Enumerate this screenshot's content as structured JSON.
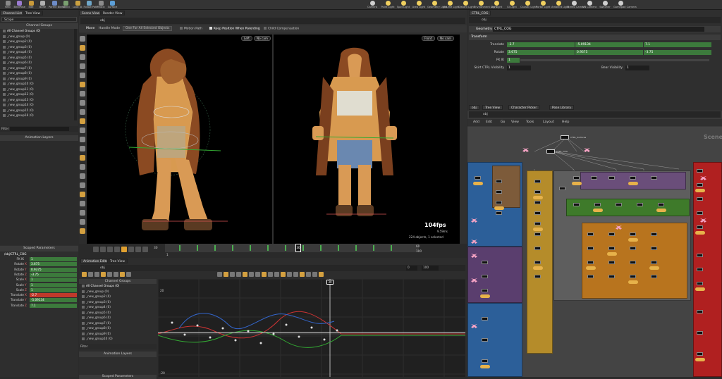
{
  "shelf_tools": [
    {
      "label": "Rest",
      "color": "#8a8a8a"
    },
    {
      "label": "BindPose",
      "color": "#9b7bd1"
    },
    {
      "label": "Edit",
      "color": "#c99a3a"
    },
    {
      "label": "Bone",
      "color": "#b0b0b0"
    },
    {
      "label": "Parent Blend",
      "color": "#6d8cc7"
    },
    {
      "label": "Blend",
      "color": "#7aa070"
    },
    {
      "label": "Look At",
      "color": "#caa040"
    },
    {
      "label": "Follow Path",
      "color": "#6fa7c9"
    },
    {
      "label": "Plastic",
      "color": "#8c8c8c"
    },
    {
      "label": "Surface",
      "color": "#5c9fd8"
    }
  ],
  "light_tools": [
    {
      "label": "Camera",
      "color": "#cfcfcf"
    },
    {
      "label": "Point Light",
      "color": "#f0d060"
    },
    {
      "label": "Spot Light",
      "color": "#f0d060"
    },
    {
      "label": "Area Light",
      "color": "#f0d060"
    },
    {
      "label": "Geometry Light",
      "color": "#f0d060"
    },
    {
      "label": "Volume Light",
      "color": "#f0d060"
    },
    {
      "label": "Distant Light",
      "color": "#f0d060"
    },
    {
      "label": "Environment Light",
      "color": "#f0d060"
    },
    {
      "label": "Sky Light",
      "color": "#f0d060"
    },
    {
      "label": "GI Light",
      "color": "#f0d060"
    },
    {
      "label": "Caustic Light",
      "color": "#f0d060"
    },
    {
      "label": "Portal Light",
      "color": "#f0d060"
    },
    {
      "label": "Ambient Light",
      "color": "#f0d060"
    },
    {
      "label": "Stereo Camera",
      "color": "#cfcfcf"
    },
    {
      "label": "VR Camera",
      "color": "#cfcfcf"
    },
    {
      "label": "Switcher",
      "color": "#cfcfcf"
    },
    {
      "label": "Gamepad Camera",
      "color": "#cfcfcf"
    }
  ],
  "left_tabs": [
    "Channel List",
    "Tree View"
  ],
  "scope_label": "Scope",
  "channel_groups": {
    "title": "Channel Groups",
    "items": [
      "All Channel Groups (0)",
      "_new_group (0)",
      "_new_group2 (0)",
      "_new_group3 (0)",
      "_new_group4 (0)",
      "_new_group5 (0)",
      "_new_group6 (0)",
      "_new_group7 (0)",
      "_new_group8 (0)",
      "_new_group9 (0)",
      "_new_group10 (0)",
      "_new_group11 (0)",
      "_new_group12 (0)",
      "_new_group13 (0)",
      "_new_group14 (0)",
      "_new_group15 (0)",
      "_new_group16 (0)"
    ]
  },
  "filter_label": "Filter",
  "anim_layers_title": "Animation Layers",
  "scoped_params": {
    "title": "Scoped Parameters",
    "node": "/obj/CTRL_COG",
    "rows": [
      {
        "name": "FK IK",
        "axis": "",
        "value": "1",
        "color": "#3c7a3c"
      },
      {
        "name": "Rotate",
        "axis": "X",
        "value": "3.675",
        "color": "#3c7a3c"
      },
      {
        "name": "Rotate",
        "axis": "Y",
        "value": "0.9375",
        "color": "#3c7a3c"
      },
      {
        "name": "Rotate",
        "axis": "Z",
        "value": "-3.75",
        "color": "#3c7a3c"
      },
      {
        "name": "Scale",
        "axis": "X",
        "value": "1",
        "color": "#3c7a3c"
      },
      {
        "name": "Scale",
        "axis": "Y",
        "value": "1",
        "color": "#3c7a3c"
      },
      {
        "name": "Scale",
        "axis": "Z",
        "value": "1",
        "color": "#3c7a3c"
      },
      {
        "name": "Translate",
        "axis": "X",
        "value": "-2.7",
        "color": "#c0392b"
      },
      {
        "name": "Translate",
        "axis": "Y",
        "value": "-5.09134",
        "color": "#3c7a3c"
      },
      {
        "name": "Translate",
        "axis": "Z",
        "value": "7.1",
        "color": "#3c7a3c"
      }
    ]
  },
  "center_tabs": [
    "Scene View",
    "Render View"
  ],
  "path_obj": "obj",
  "viewport_toolbar": {
    "mode": "Move",
    "handle": "Handle Mode",
    "objects": "One For All Selected Objects",
    "motion_path": "Motion Path",
    "keep_pos": "Keep Position When Parenting",
    "child_comp": "Child Compensation"
  },
  "viewport_left": {
    "view": "Left",
    "cam": "No cam"
  },
  "viewport_right": {
    "view": "Front",
    "cam": "No cam"
  },
  "fps": "104fps",
  "fps_sub": "9.59ms",
  "objects_status": "224 objects, 1 selected",
  "timeline": {
    "start": "1",
    "current": "30",
    "end": "60",
    "end2": "100",
    "frame_marker": "30"
  },
  "anim_editor": {
    "tabs": [
      "Animation Editor",
      "Tree View"
    ],
    "path": "obj",
    "frame_start": "0",
    "frame_end": "100",
    "graph_frame": "30",
    "y_top": "20",
    "y_bottom": "-20"
  },
  "anim_channel_groups": {
    "title": "Channel Groups",
    "items": [
      "All Channel Groups (0)",
      "_new_group (0)",
      "_new_group2 (0)",
      "_new_group3 (0)",
      "_new_group4 (0)",
      "_new_group5 (0)",
      "_new_group6 (0)",
      "_new_group7 (0)",
      "_new_group8 (0)",
      "_new_group9 (0)",
      "_new_group10 (0)"
    ]
  },
  "anim_filter": "Filter",
  "anim_layers2": "Animation Layers",
  "scoped_params2": "Scoped Parameters",
  "props": {
    "tab": "CTRL_COG",
    "path": "obj",
    "type": "Geometry",
    "name": "CTRL_COG",
    "section": "Transform",
    "translate": {
      "label": "Translate",
      "x": "-2.7",
      "y": "-5.09134",
      "z": "7.1"
    },
    "rotate": {
      "label": "Rotate",
      "x": "3.675",
      "y": "0.9375",
      "z": "-3.75"
    },
    "fkik": {
      "label": "FK IK",
      "value": "1"
    },
    "skirt": {
      "label": "Skirt CTRL Visibility",
      "value": "1"
    },
    "bear": {
      "label": "Bear Visibility",
      "value": "1"
    }
  },
  "net": {
    "tabs": [
      "obj",
      "Tree View",
      "Character Picker",
      "Pose Library"
    ],
    "path": "obj",
    "menu": [
      "Add",
      "Edit",
      "Go",
      "View",
      "Tools",
      "Layout",
      "Help"
    ],
    "scene_label": "Scene",
    "node_top": "CTRL_Surfaces",
    "node_cog": "CTRL_COG"
  }
}
